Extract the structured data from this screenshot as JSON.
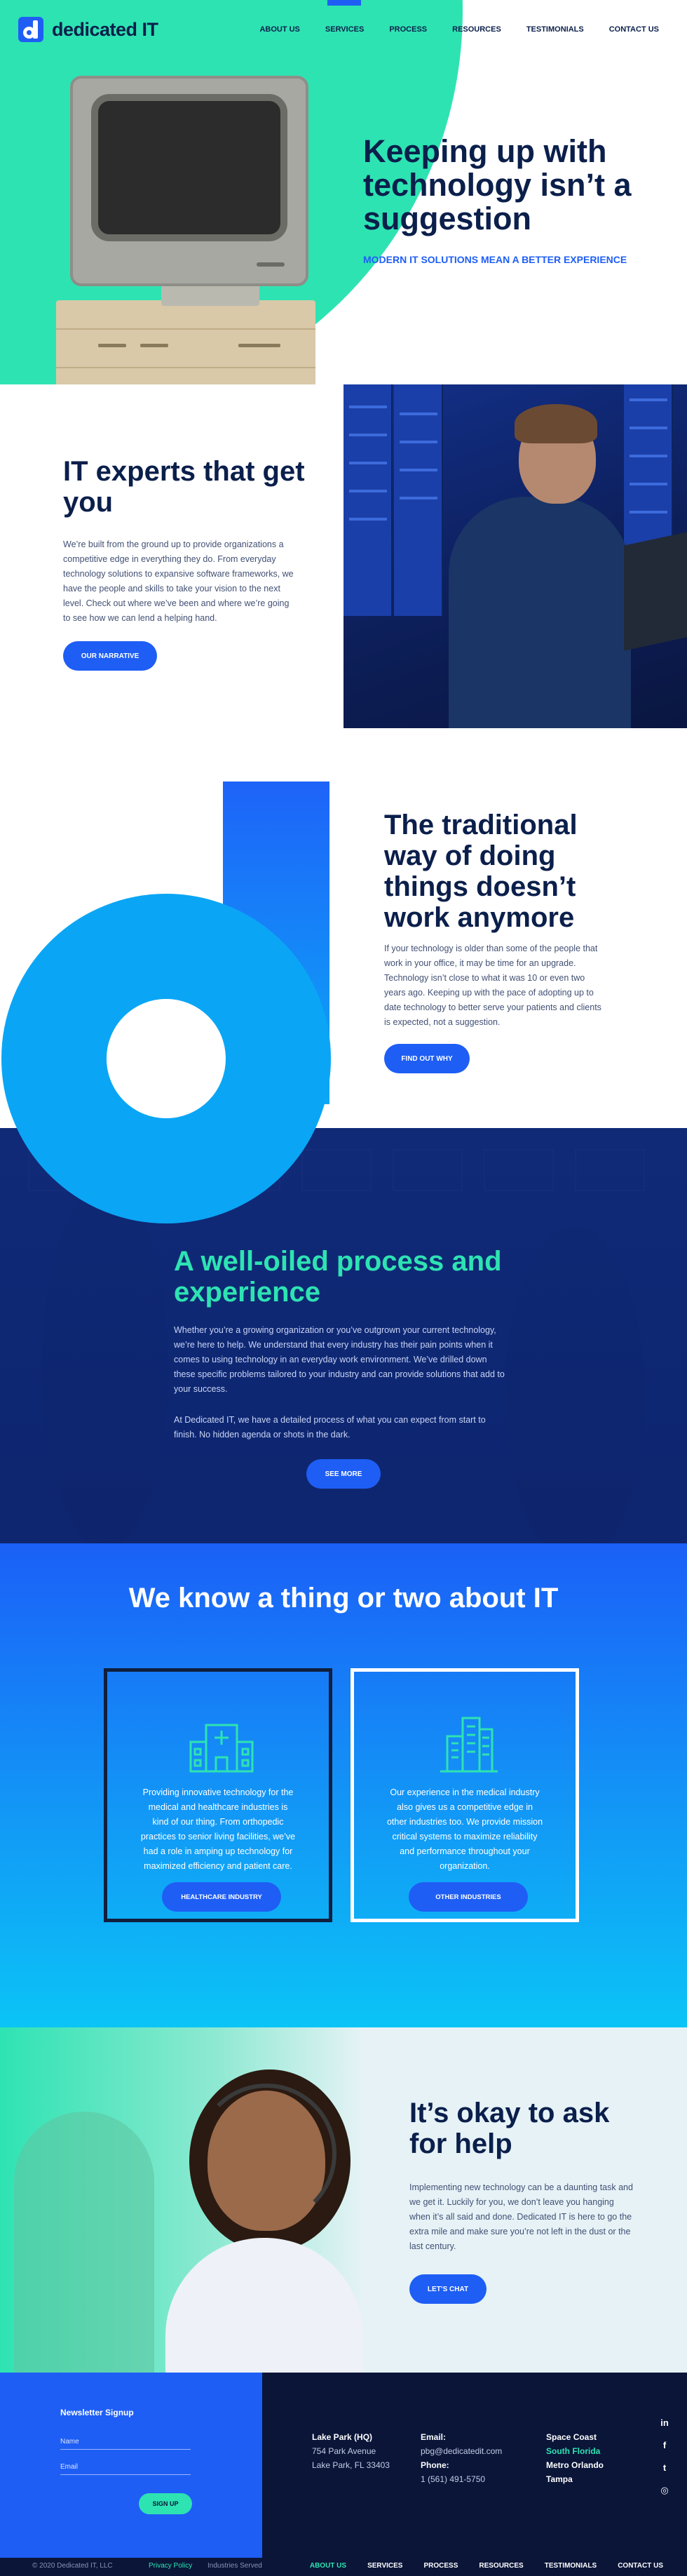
{
  "brand": {
    "name": "dedicated IT",
    "accent": "#1e5ef5",
    "mint": "#2ee3b2",
    "navy": "#0b1f4b"
  },
  "nav": {
    "items": [
      {
        "label": "ABOUT US"
      },
      {
        "label": "SERVICES"
      },
      {
        "label": "PROCESS"
      },
      {
        "label": "RESOURCES"
      },
      {
        "label": "TESTIMONIALS"
      },
      {
        "label": "CONTACT US"
      }
    ]
  },
  "hero": {
    "title": "Keeping up with technology isn’t a suggestion",
    "subtitle": "MODERN IT SOLUTIONS MEAN A BETTER EXPERIENCE"
  },
  "experts": {
    "title": "IT experts that get you",
    "body": "We’re built from the ground up to provide organizations a competitive edge in everything they do. From everyday technology solutions to expansive software frameworks, we have the people and skills to take your vision to the next level. Check out where we’ve been and where we’re going to see how we can lend a helping hand.",
    "button": "OUR NARRATIVE"
  },
  "traditional": {
    "title": "The traditional way of doing things doesn’t work anymore",
    "body": "If your technology is older than some of the people that work in your office, it may be time for an upgrade. Technology isn’t close to what it was 10 or even two years ago. Keeping up with the pace of adopting up to date technology to better serve your patients and clients is expected, not a suggestion.",
    "button": "FIND OUT WHY"
  },
  "process": {
    "title": "A well-oiled process and experience",
    "body1": "Whether you’re a growing organization or you’ve outgrown your current technology, we’re here to help. We understand that every industry has their pain points when it comes to using technology in an everyday work environment. We’ve drilled down these specific problems tailored to your industry and can provide solutions that add to your success.",
    "body2": "At Dedicated IT, we have a detailed process of what you can expect from start to finish. No hidden agenda or shots in the dark.",
    "button": "SEE MORE"
  },
  "knowit": {
    "title": "We know a thing or two about IT",
    "cards": [
      {
        "icon": "hospital-icon",
        "text": "Providing innovative technology for the medical and healthcare industries is kind of our thing. From orthopedic practices to senior living facilities, we’ve had a role in amping up technology for maximized efficiency and patient care.",
        "button": "HEALTHCARE INDUSTRY"
      },
      {
        "icon": "buildings-icon",
        "text": "Our experience in the medical industry also gives us a competitive edge in other industries too. We provide mission critical systems to maximize reliability and performance throughout your organization.",
        "button": "OTHER INDUSTRIES"
      }
    ]
  },
  "help": {
    "title": "It’s okay to ask for help",
    "body": "Implementing new technology can be a daunting task and we get it. Luckily for you, we don’t leave you hanging when it’s all said and done. Dedicated IT is here to go the extra mile and make sure you’re not left in the dust or the last century.",
    "button": "LET’S CHAT"
  },
  "footer": {
    "newsletter": {
      "title": "Newsletter Signup",
      "name_placeholder": "Name",
      "email_placeholder": "Email",
      "button": "SIGN UP"
    },
    "office": {
      "title": "Lake Park (HQ)",
      "line1": "754 Park Avenue",
      "line2": "Lake Park, FL 33403"
    },
    "contact": {
      "email_label": "Email:",
      "email": "pbg@dedicatedit.com",
      "phone_label": "Phone:",
      "phone": "1 (561) 491-5750"
    },
    "locations": [
      {
        "label": "Space Coast"
      },
      {
        "label": "South Florida"
      },
      {
        "label": "Metro Orlando"
      },
      {
        "label": "Tampa"
      }
    ],
    "social": [
      {
        "icon": "linkedin-icon",
        "glyph": "in"
      },
      {
        "icon": "facebook-icon",
        "glyph": "f"
      },
      {
        "icon": "twitter-icon",
        "glyph": "t"
      },
      {
        "icon": "instagram-icon",
        "glyph": "◎"
      }
    ],
    "copyright": "© 2020 Dedicated IT, LLC",
    "links": [
      {
        "label": "Privacy Policy"
      },
      {
        "label": "Industries Served"
      }
    ],
    "nav": [
      {
        "label": "ABOUT US"
      },
      {
        "label": "SERVICES"
      },
      {
        "label": "PROCESS"
      },
      {
        "label": "RESOURCES"
      },
      {
        "label": "TESTIMONIALS"
      },
      {
        "label": "CONTACT US"
      }
    ]
  }
}
